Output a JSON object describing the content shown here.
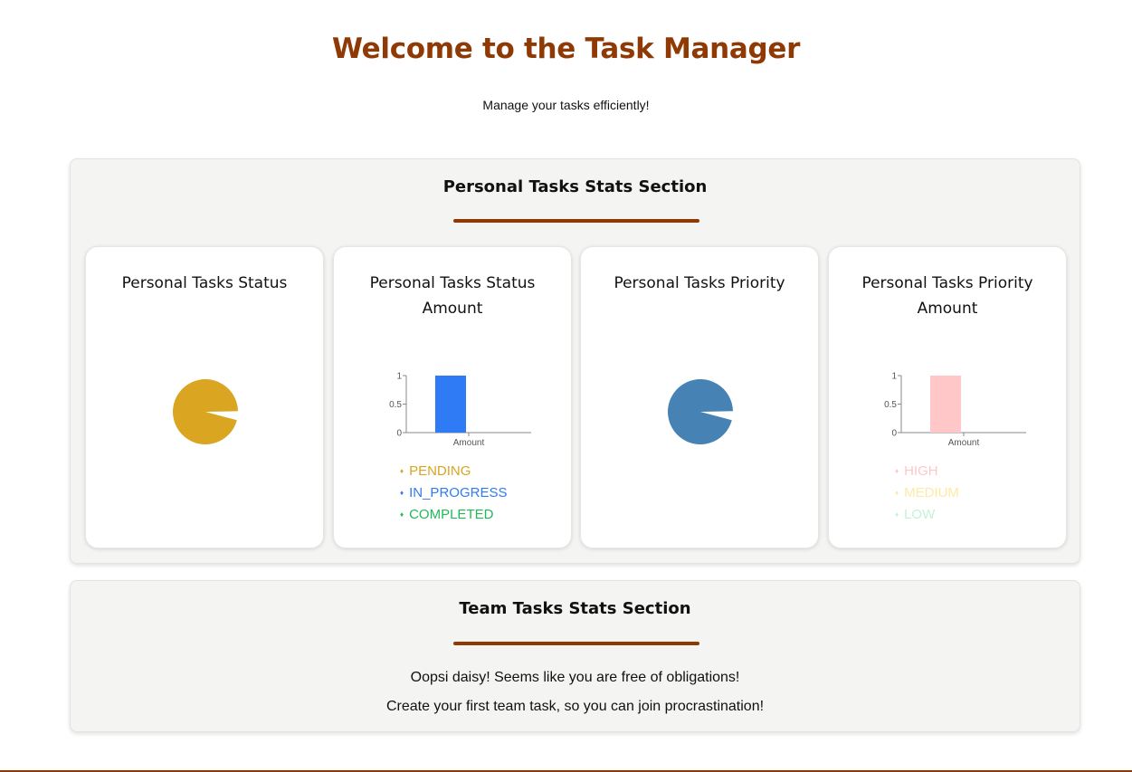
{
  "header": {
    "title": "Welcome to the Task Manager",
    "subtitle": "Manage your tasks efficiently!"
  },
  "personal_section": {
    "title": "Personal Tasks Stats Section",
    "cards": [
      {
        "title": "Personal Tasks Status"
      },
      {
        "title": "Personal Tasks Status Amount"
      },
      {
        "title": "Personal Tasks Priority"
      },
      {
        "title": "Personal Tasks Priority Amount"
      }
    ]
  },
  "team_section": {
    "title": "Team Tasks Stats Section",
    "message_1": "Oopsi daisy! Seems like you are free of obligations!",
    "message_2": "Create your first team task, so you can join procrastination!"
  },
  "colors": {
    "accent": "#8f3a05",
    "pending": "#daa520",
    "in_progress": "#2f7bf5",
    "completed": "#22b95a",
    "high": "#ffc7c7",
    "medium": "#fdeaa5",
    "low": "#c4f2d8",
    "priority_pie": "#4682b4"
  },
  "chart_data": [
    {
      "type": "pie",
      "title": "Personal Tasks Status",
      "slices": [
        {
          "label": "",
          "value": 1
        }
      ],
      "color": "#daa520"
    },
    {
      "type": "bar",
      "title": "Personal Tasks Status Amount",
      "categories": [
        "Amount"
      ],
      "series": [
        {
          "name": "PENDING",
          "values": [
            0
          ]
        },
        {
          "name": "IN_PROGRESS",
          "values": [
            1
          ]
        },
        {
          "name": "COMPLETED",
          "values": [
            0
          ]
        }
      ],
      "yticks": [
        "0",
        "0.5",
        "1"
      ],
      "ylim": [
        0,
        1
      ],
      "legend": "bottom"
    },
    {
      "type": "pie",
      "title": "Personal Tasks Priority",
      "slices": [
        {
          "label": "",
          "value": 1
        }
      ],
      "color": "#4682b4"
    },
    {
      "type": "bar",
      "title": "Personal Tasks Priority Amount",
      "categories": [
        "Amount"
      ],
      "series": [
        {
          "name": "HIGH",
          "values": [
            1
          ]
        },
        {
          "name": "MEDIUM",
          "values": [
            0
          ]
        },
        {
          "name": "LOW",
          "values": [
            0
          ]
        }
      ],
      "yticks": [
        "0",
        "0.5",
        "1"
      ],
      "ylim": [
        0,
        1
      ],
      "legend": "bottom"
    }
  ]
}
